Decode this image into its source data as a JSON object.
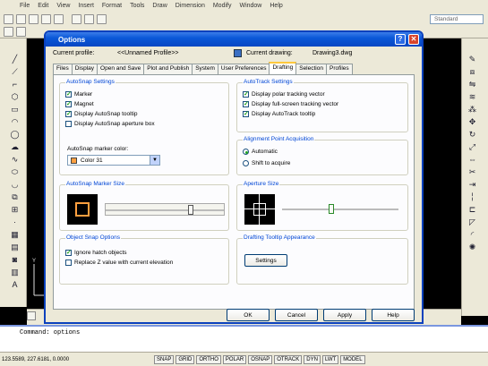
{
  "menubar": {
    "items": [
      "File",
      "Edit",
      "View",
      "Insert",
      "Format",
      "Tools",
      "Draw",
      "Dimension",
      "Modify",
      "Window",
      "Help"
    ]
  },
  "toolbar": {
    "style_value": "Standard"
  },
  "dialog": {
    "title": "Options",
    "current_profile_label": "Current profile:",
    "current_profile_value": "<<Unnamed Profile>>",
    "current_drawing_label": "Current drawing:",
    "current_drawing_value": "Drawing3.dwg",
    "tabs": [
      "Files",
      "Display",
      "Open and Save",
      "Plot and Publish",
      "System",
      "User Preferences",
      "Drafting",
      "Selection",
      "Profiles"
    ],
    "active_tab": "Drafting",
    "autosnap": {
      "title": "AutoSnap Settings",
      "items": [
        {
          "label": "Marker",
          "checked": true
        },
        {
          "label": "Magnet",
          "checked": true
        },
        {
          "label": "Display AutoSnap tooltip",
          "checked": true
        },
        {
          "label": "Display AutoSnap aperture box",
          "checked": false
        }
      ],
      "color_label": "AutoSnap marker color:",
      "color_value": "Color 31",
      "color_swatch": "#ff9f3f"
    },
    "autotrack": {
      "title": "AutoTrack Settings",
      "items": [
        {
          "label": "Display polar tracking vector",
          "checked": true
        },
        {
          "label": "Display full-screen tracking vector",
          "checked": true
        },
        {
          "label": "Display AutoTrack tooltip",
          "checked": true
        }
      ]
    },
    "alignment": {
      "title": "Alignment Point Acquisition",
      "options": [
        {
          "label": "Automatic",
          "selected": true
        },
        {
          "label": "Shift to acquire",
          "selected": false
        }
      ]
    },
    "marker_size": {
      "title": "AutoSnap Marker Size",
      "level": 0.73
    },
    "aperture_size": {
      "title": "Aperture Size",
      "level": 0.42
    },
    "object_snap": {
      "title": "Object Snap Options",
      "items": [
        {
          "label": "Ignore hatch objects",
          "checked": true
        },
        {
          "label": "Replace Z value with current elevation",
          "checked": false
        }
      ]
    },
    "tooltip_appearance": {
      "title": "Drafting Tooltip Appearance",
      "settings_button": "Settings"
    },
    "buttons": {
      "ok": "OK",
      "cancel": "Cancel",
      "apply": "Apply",
      "help": "Help"
    }
  },
  "command_line": {
    "line1": "Command: options"
  },
  "status_bar": {
    "coords": "123.5589, 227.6181, 0.0000",
    "toggles": [
      "SNAP",
      "GRID",
      "ORTHO",
      "POLAR",
      "OSNAP",
      "OTRACK",
      "DYN",
      "LWT",
      "MODEL"
    ]
  }
}
